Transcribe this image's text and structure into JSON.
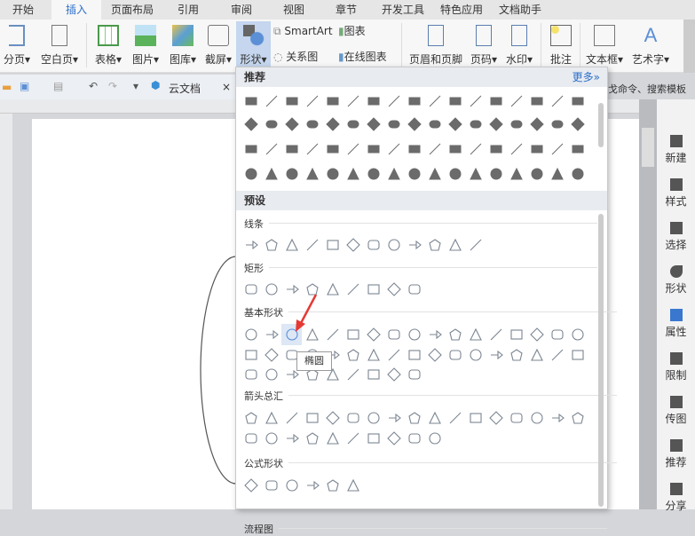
{
  "tabs": [
    "开始",
    "插入",
    "页面布局",
    "引用",
    "审阅",
    "视图",
    "章节",
    "开发工具",
    "特色应用",
    "文档助手"
  ],
  "active_tab": "插入",
  "ribbon": {
    "page_break": "分页",
    "blank_page": "空白页",
    "table": "表格",
    "picture": "图片",
    "gallery": "图库",
    "screenshot": "截屏",
    "shapes": "形状",
    "smartart": "SmartArt",
    "chart": "图表",
    "relation": "关系图",
    "online_chart": "在线图表",
    "header_footer": "页眉和页脚",
    "page_number": "页码",
    "watermark": "水印",
    "comment": "批注",
    "textbox": "文本框",
    "wordart": "艺术字"
  },
  "quick_access": {
    "cloud_doc": "云文档",
    "close": "×"
  },
  "search_hint": "戈命令、搜索模板",
  "panel": {
    "recommended": "推荐",
    "more": "更多»",
    "presets": "预设",
    "sections": [
      "线条",
      "矩形",
      "基本形状",
      "箭头总汇",
      "公式形状",
      "流程图"
    ],
    "tooltip": "椭圆"
  },
  "sidebar": [
    "新建",
    "样式",
    "选择",
    "形状",
    "属性",
    "限制",
    "传图",
    "推荐",
    "分享"
  ],
  "colors": {
    "accent": "#2b6fc8",
    "arrow": "#e53935"
  }
}
